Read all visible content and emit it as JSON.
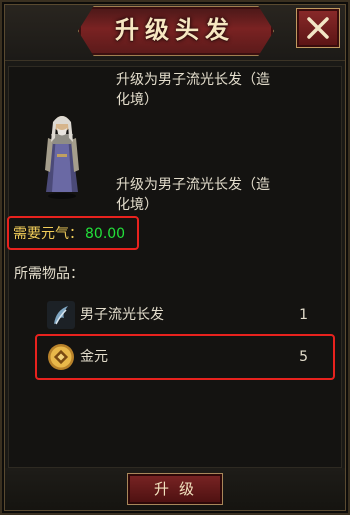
{
  "dialog": {
    "title": "升级头发",
    "close_icon": "close-x-icon"
  },
  "result": {
    "title_line1": "升级为男子流光长发（造",
    "title_line2": "化境）",
    "desc_line1": "升级为男子流光长发（造",
    "desc_line2": "化境）"
  },
  "requirement": {
    "label": "需要元气：",
    "value": "80.00"
  },
  "items": {
    "label": "所需物品：",
    "list": [
      {
        "name": "男子流光长发",
        "qty": "1",
        "icon": "hair-icon"
      },
      {
        "name": "金元",
        "qty": "5",
        "icon": "gold-coin-icon"
      }
    ]
  },
  "footer": {
    "upgrade_label": "升级"
  },
  "colors": {
    "accent_red": "#7a2222",
    "highlight_border": "#e8221e",
    "value_green": "#22e03a",
    "label_yellow": "#f2ce5a"
  }
}
